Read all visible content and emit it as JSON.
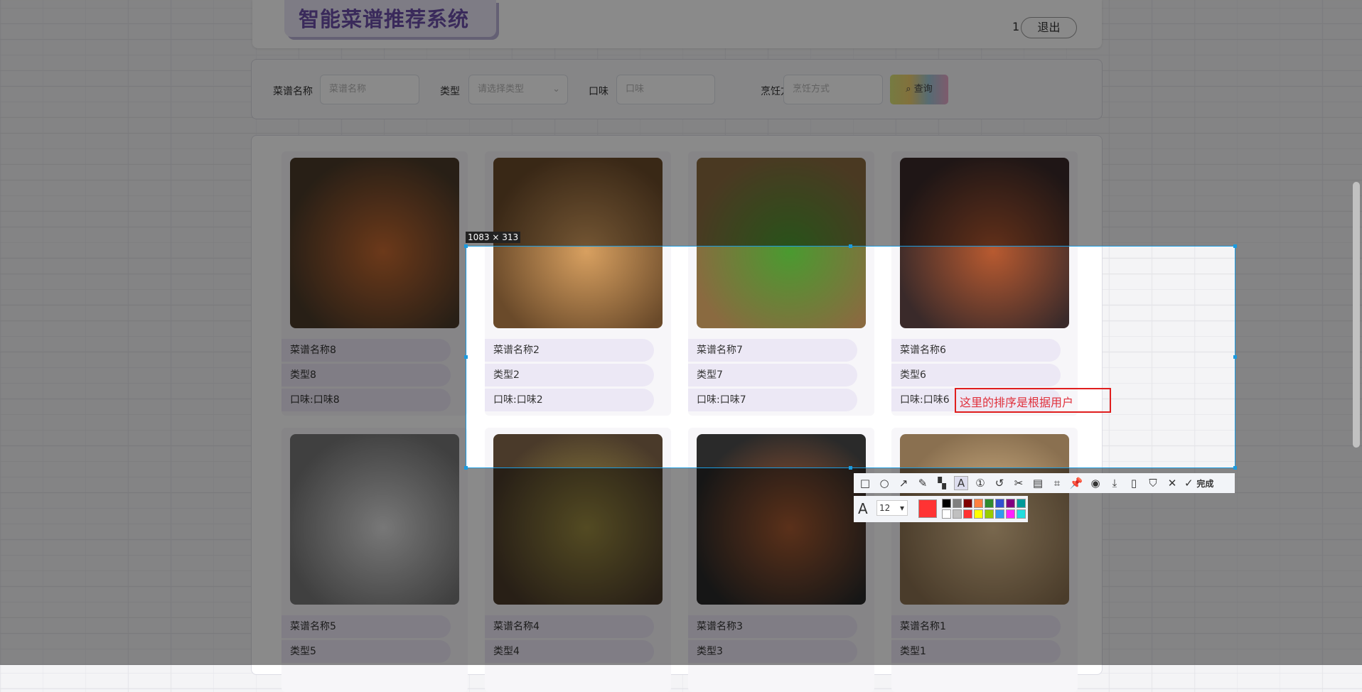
{
  "header": {
    "title": "智能菜谱推荐系统",
    "user": "1",
    "logout": "退出"
  },
  "search": {
    "name_label": "菜谱名称",
    "name_placeholder": "菜谱名称",
    "type_label": "类型",
    "type_placeholder": "请选择类型",
    "taste_label": "口味",
    "taste_placeholder": "口味",
    "cook_label": "烹饪方式",
    "cook_placeholder": "烹饪方式",
    "query": "查询"
  },
  "recipes": [
    {
      "name": "菜谱名称8",
      "type": "类型8",
      "taste": "口味:口味8",
      "c": [
        "#4a3a2a",
        "#c86a30"
      ]
    },
    {
      "name": "菜谱名称2",
      "type": "类型2",
      "taste": "口味:口味2",
      "c": [
        "#6a4a2a",
        "#d8a060"
      ]
    },
    {
      "name": "菜谱名称7",
      "type": "类型7",
      "taste": "口味:口味7",
      "c": [
        "#8a6a40",
        "#4a9a30"
      ]
    },
    {
      "name": "菜谱名称6",
      "type": "类型6",
      "taste": "口味:口味6",
      "c": [
        "#3a2a2a",
        "#b85a30"
      ]
    },
    {
      "name": "菜谱名称5",
      "type": "类型5",
      "taste": "",
      "c": [
        "#777",
        "#ddd"
      ]
    },
    {
      "name": "菜谱名称4",
      "type": "类型4",
      "taste": "",
      "c": [
        "#4a3a2a",
        "#9a8a40"
      ]
    },
    {
      "name": "菜谱名称3",
      "type": "类型3",
      "taste": "",
      "c": [
        "#2a2a2a",
        "#a85a30"
      ]
    },
    {
      "name": "菜谱名称1",
      "type": "类型1",
      "taste": "",
      "c": [
        "#8a7050",
        "#e0c090"
      ]
    }
  ],
  "screenshot_tool": {
    "size": "1083 × 313",
    "annotation_text": "这里的排序是根据用户",
    "font_size": "12",
    "done": "完成",
    "current_color": "#ff3333",
    "palette": [
      "#000000",
      "#808080",
      "#800000",
      "#ff8040",
      "#2e8b2e",
      "#3050d0",
      "#800080",
      "#009999",
      "#ffffff",
      "#c0c0c0",
      "#ff3333",
      "#ffff00",
      "#99cc00",
      "#3399ee",
      "#ff22ff",
      "#22dddd"
    ]
  }
}
